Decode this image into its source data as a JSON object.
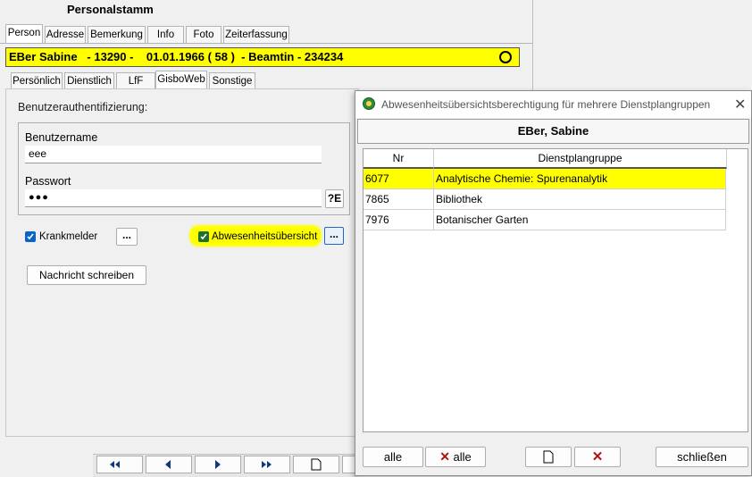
{
  "main": {
    "title": "Personalstamm",
    "tabs": [
      "Person",
      "Adresse",
      "Bemerkung",
      "Info",
      "Foto",
      "Zeiterfassung"
    ],
    "banner": {
      "text": "EBer Sabine   - 13290 -    01.01.1966 ( 58 )  - Beamtin - 234234",
      "color": "#ffff00"
    },
    "subtabs": [
      "Persönlich",
      "Dienstlich",
      "LfF",
      "GisboWeb",
      "Sonstige"
    ],
    "section_label": "Benutzerauthentifizierung:",
    "username_label": "Benutzername",
    "username_value": "eee",
    "password_label": "Passwort",
    "password_value": "●●●",
    "krankmelder_label": "Krankmelder",
    "abwesenheit_label": "Abwesenheitsübersicht",
    "dots_label": "...",
    "message_button": "Nachricht schreiben",
    "highlight_color": "#ffff00"
  },
  "dialog": {
    "title": "Abwesenheitsübersichtsberechtigung für mehrere Dienstplangruppen",
    "person": "EBer, Sabine",
    "columns": [
      "Nr",
      "Dienstplangruppe"
    ],
    "rows": [
      {
        "nr": "6077",
        "name": "Analytische Chemie: Spurenanalytik",
        "selected": true
      },
      {
        "nr": "7865",
        "name": "Bibliothek",
        "selected": false
      },
      {
        "nr": "7976",
        "name": "Botanischer Garten",
        "selected": false
      }
    ],
    "buttons": {
      "all": "alle",
      "none": "alle",
      "close": "schließen"
    }
  }
}
